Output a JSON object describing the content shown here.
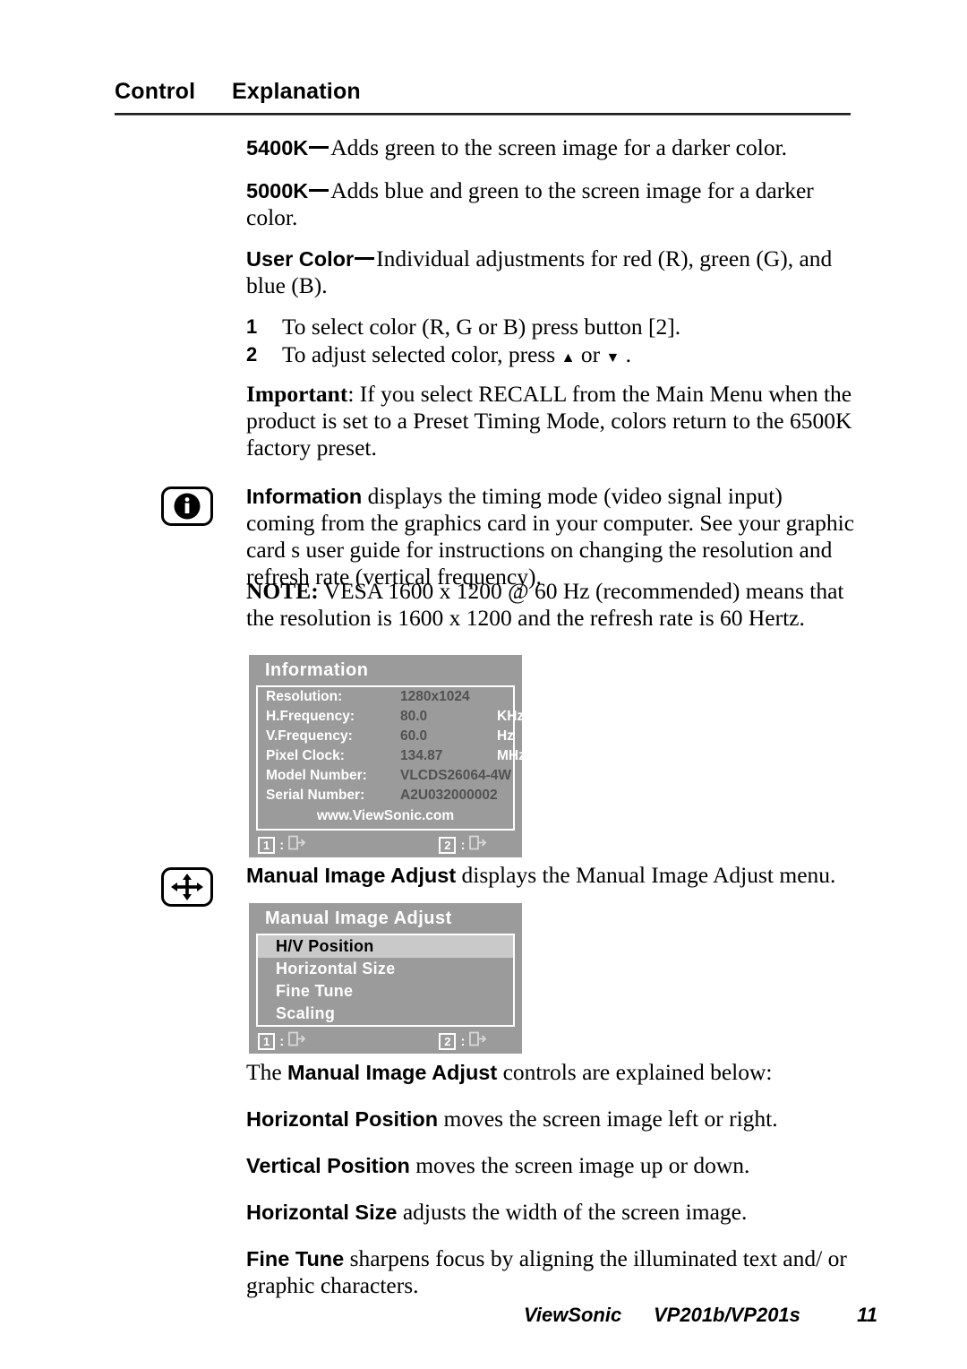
{
  "header": {
    "col_control": "Control",
    "col_explanation": "Explanation"
  },
  "entries": {
    "k5400": {
      "term": "5400K",
      "text": "Adds green to the screen image for a darker color."
    },
    "k5000": {
      "term": "5000K",
      "text": "Adds blue and green to the screen image for a darker color."
    },
    "user_color": {
      "term": "User Color",
      "text": "Individual adjustments for red (R), green (G), and blue (B)."
    }
  },
  "steps": [
    {
      "num": "1",
      "text": "To select color (R, G or B) press button [2]."
    },
    {
      "num": "2",
      "text_before": "To adjust selected color, press ",
      "text_mid": " or ",
      "text_after": " ."
    }
  ],
  "important": {
    "label": "Important",
    "text": ": If you select RECALL from the Main Menu when the product is set to a Preset Timing Mode, colors return to the 6500K factory preset."
  },
  "information": {
    "icon": "info-icon",
    "label": "Information",
    "text": " displays the timing mode (video signal input) coming from the graphics card in your computer. See your graphic card s user guide for instructions on changing the resolution and refresh rate (vertical frequency).",
    "note_label": "NOTE:",
    "note_text": " VESA 1600 x 1200 @ 60 Hz (recommended) means that the resolution is 1600 x 1200 and the refresh rate is 60 Hertz."
  },
  "osd_information": {
    "title": "Information",
    "rows": [
      {
        "label": "Resolution:",
        "value": "1280x1024",
        "unit": ""
      },
      {
        "label": "H.Frequency:",
        "value": "80.0",
        "unit": "KHz"
      },
      {
        "label": "V.Frequency:",
        "value": "60.0",
        "unit": "Hz"
      },
      {
        "label": "Pixel Clock:",
        "value": "134.87",
        "unit": "MHz"
      },
      {
        "label": "Model Number:",
        "value": "VLCDS26064-4W",
        "unit": ""
      },
      {
        "label": "Serial Number:",
        "value": "A2U032000002",
        "unit": ""
      }
    ],
    "website": "www.ViewSonic.com",
    "footer": {
      "key1": "1",
      "colon1": ":",
      "icon1": "exit-icon",
      "key2": "2",
      "colon2": ":",
      "icon2": "exit-icon"
    }
  },
  "manual_image_adjust": {
    "icon": "four-way-arrow-icon",
    "label": "Manual Image Adjust",
    "text": " displays the Manual Image Adjust menu."
  },
  "osd_manual": {
    "title": "Manual Image Adjust",
    "items": [
      {
        "label": "H/V Position",
        "selected": true
      },
      {
        "label": "Horizontal Size",
        "selected": false
      },
      {
        "label": "Fine Tune",
        "selected": false
      },
      {
        "label": "Scaling",
        "selected": false
      }
    ],
    "footer": {
      "key1": "1",
      "colon1": ":",
      "icon1": "exit-icon",
      "key2": "2",
      "colon2": ":",
      "icon2": "exit-icon"
    }
  },
  "controls_intro": {
    "before": "The ",
    "bold": "Manual Image Adjust",
    "after": " controls are explained below:"
  },
  "controls": [
    {
      "term": "Horizontal Position",
      "text": " moves the screen image left or right."
    },
    {
      "term": "Vertical Position",
      "text": " moves the screen image up or down."
    },
    {
      "term": "Horizontal Size",
      "text": " adjusts the width of the screen image."
    },
    {
      "term": "Fine Tune",
      "text": " sharpens focus by aligning the illuminated text and/ or graphic characters."
    }
  ],
  "footer": {
    "brand": "ViewSonic",
    "model": "VP201b/VP201s",
    "page": "11"
  }
}
